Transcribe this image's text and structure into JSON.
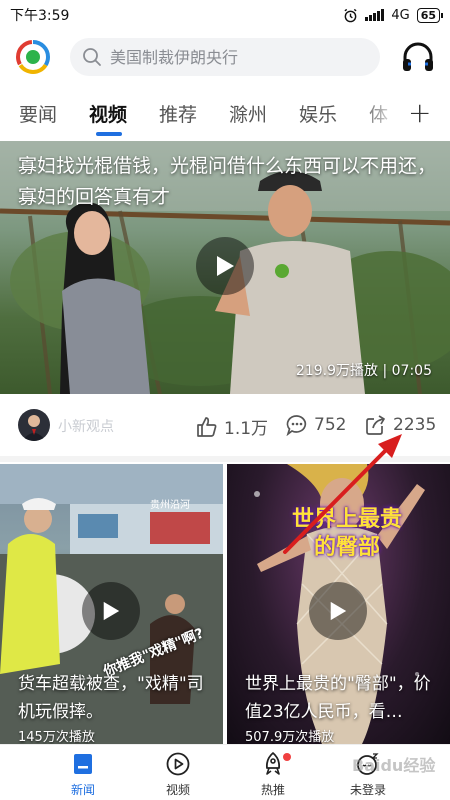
{
  "status_bar": {
    "time": "下午3:59",
    "network": "4G",
    "battery": "65"
  },
  "header": {
    "search_placeholder": "美国制裁伊朗央行"
  },
  "tabs": [
    {
      "label": "要闻"
    },
    {
      "label": "视频"
    },
    {
      "label": "推荐"
    },
    {
      "label": "滁州"
    },
    {
      "label": "娱乐"
    },
    {
      "label": "体"
    }
  ],
  "active_tab": "视频",
  "main_video": {
    "title": "寡妇找光棍借钱，光棍问借什么东西可以不用还，寡妇的回答真有才",
    "views": "219.9万播放",
    "duration": "07:05",
    "author": "小新观点",
    "likes": "1.1万",
    "comments": "752",
    "shares": "2235"
  },
  "cards": [
    {
      "title": "货车超载被查，\"戏精\"司机玩假摔。",
      "views": "145万次播放",
      "tag": "贵州沿河",
      "overlay_text": "你推我\"戏精\"啊?"
    },
    {
      "title": "世界上最贵的\"臀部\"，价值23亿人民币，看…",
      "views": "507.9万次播放",
      "headline": "世界上最贵的臀部"
    }
  ],
  "bottom_nav": [
    {
      "label": "新闻",
      "icon": "news-icon"
    },
    {
      "label": "视频",
      "icon": "video-play-icon"
    },
    {
      "label": "热推",
      "icon": "rocket-icon"
    },
    {
      "label": "未登录",
      "icon": "sleep-user-icon"
    }
  ],
  "watermark": "Baidu经验",
  "colors": {
    "accent": "#1f6fe0",
    "annotation_arrow": "#d81e1e"
  }
}
